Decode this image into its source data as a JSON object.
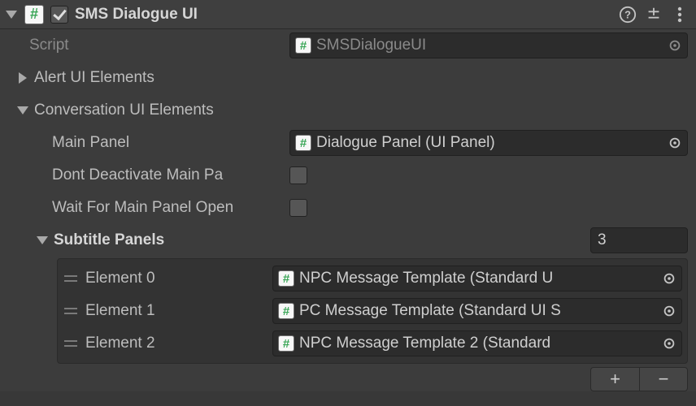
{
  "header": {
    "title": "SMS Dialogue UI",
    "enabled": true
  },
  "scriptRow": {
    "label": "Script",
    "value": "SMSDialogueUI"
  },
  "alertSection": {
    "label": "Alert UI Elements",
    "expanded": false
  },
  "convSection": {
    "label": "Conversation UI Elements",
    "expanded": true,
    "mainPanel": {
      "label": "Main Panel",
      "value": "Dialogue Panel (UI Panel)"
    },
    "dontDeactivate": {
      "label": "Dont Deactivate Main Pa",
      "checked": false
    },
    "waitForOpen": {
      "label": "Wait For Main Panel Open",
      "checked": false
    },
    "subtitlePanels": {
      "label": "Subtitle Panels",
      "size": "3",
      "items": [
        {
          "label": "Element 0",
          "value": "NPC Message Template (Standard U"
        },
        {
          "label": "Element 1",
          "value": "PC Message Template (Standard UI S"
        },
        {
          "label": "Element 2",
          "value": "NPC Message Template 2 (Standard"
        }
      ]
    }
  },
  "icons": {
    "hash": "#",
    "plus": "+",
    "minus": "−"
  }
}
